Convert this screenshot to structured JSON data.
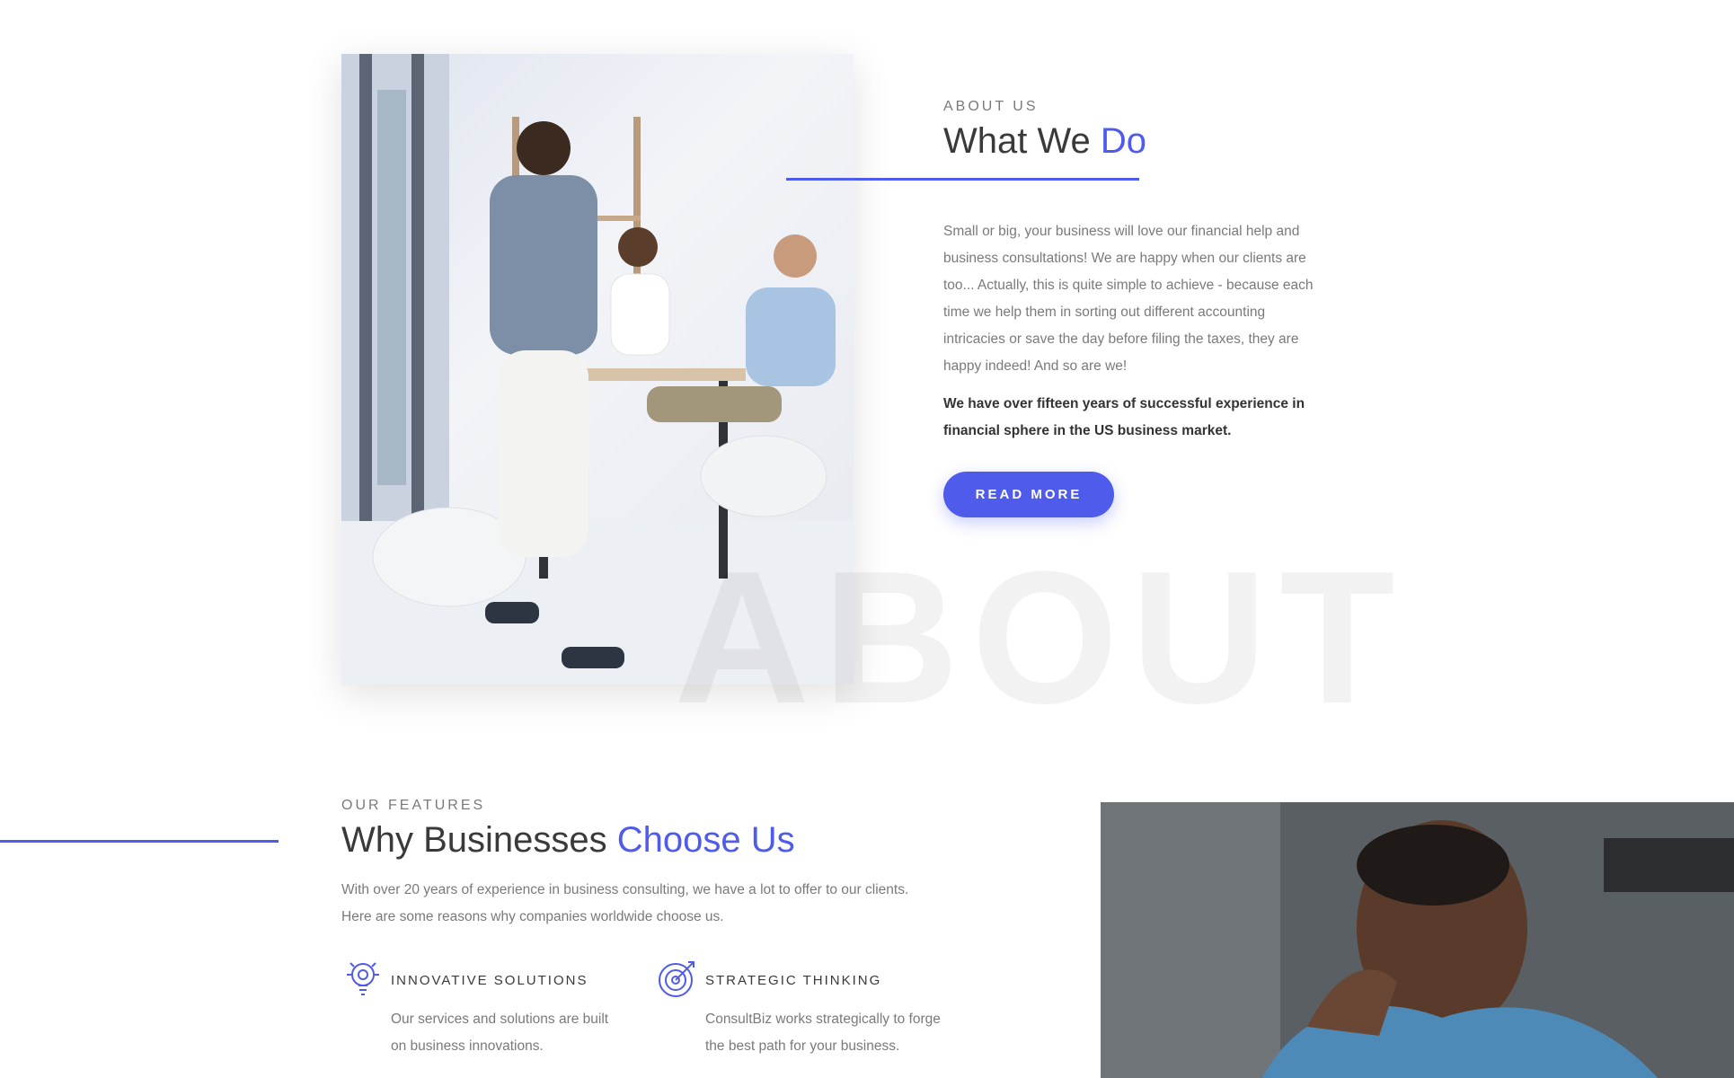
{
  "about": {
    "eyebrow": "ABOUT US",
    "title_main": "What We ",
    "title_accent": "Do",
    "paragraph": "Small or big, your business will love our financial help and business consultations! We are happy when our clients are too... Actually, this is quite simple to achieve - because each time we help them in sorting out different accounting intricacies or save the day before filing the taxes, they are happy indeed! And so are we!",
    "bold_paragraph": "We have over fifteen years of successful experience in financial sphere in the US business market.",
    "button_label": "READ MORE",
    "watermark": "ABOUT"
  },
  "features": {
    "eyebrow": "OUR FEATURES",
    "title_main": "Why Businesses ",
    "title_accent": "Choose Us",
    "paragraph": "With over 20 years of experience in business consulting, we have a lot to offer to our clients. Here are some reasons why companies worldwide choose us.",
    "items": [
      {
        "title": "INNOVATIVE SOLUTIONS",
        "text": "Our services and solutions are built on business innovations.",
        "icon": "lightbulb-gear-icon"
      },
      {
        "title": "STRATEGIC THINKING",
        "text": "ConsultBiz works strategically to forge the best path for your business.",
        "icon": "target-arrow-icon"
      }
    ]
  },
  "colors": {
    "accent": "#4f5bea",
    "text": "#3a3a3a",
    "muted": "#7a7a7a"
  }
}
